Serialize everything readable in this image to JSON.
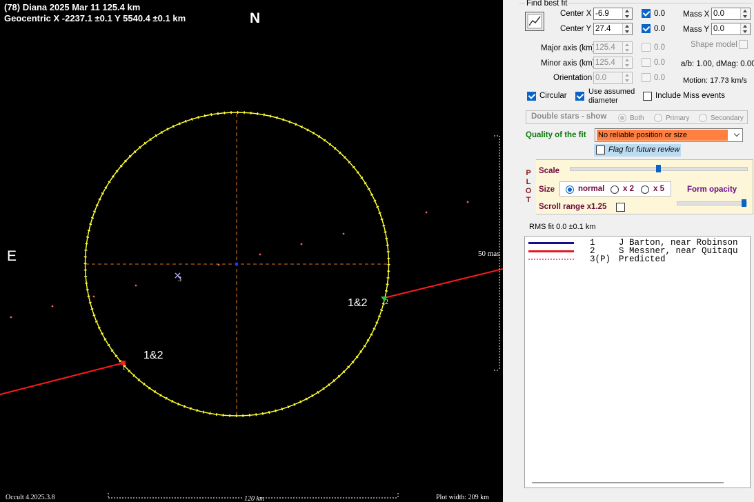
{
  "plot": {
    "title": "(78) Diana  2025 Mar 11   125.4 km",
    "geocentric": "Geocentric  X  -2237.1 ±0.1  Y 5540.4 ±0.1 km",
    "north_label": "N",
    "east_label": "E",
    "chord_label_right": "1&2",
    "chord_label_left": "1&2",
    "scale_mas_label": "50 mas",
    "version": "Occult 4.2025.3.8",
    "scale_km_label": "120 km",
    "plot_width": "Plot width: 209 km",
    "markers": {
      "chord1_end": "1",
      "chord2_end": "2",
      "predicted": "3"
    },
    "colors": {
      "ellipse": "#ffff33",
      "chord": "#ff1a1a",
      "axes": "#e07a1a",
      "predicted": "#ff6060",
      "center": "#2030ff"
    }
  },
  "panel": {
    "find_best_fit": "Find best fit",
    "center_x": {
      "label": "Center X",
      "value": "-6.9",
      "check": "0.0"
    },
    "center_y": {
      "label": "Center Y",
      "value": "27.4",
      "check": "0.0"
    },
    "mass_x": {
      "label": "Mass X",
      "value": "0.0"
    },
    "mass_y": {
      "label": "Mass Y",
      "value": "0.0"
    },
    "major_axis": {
      "label": "Major axis (km)",
      "value": "125.4",
      "check": "0.0"
    },
    "minor_axis": {
      "label": "Minor axis (km)",
      "value": "125.4",
      "check": "0.0"
    },
    "orientation": {
      "label": "Orientation",
      "value": "0.0",
      "check": "0.0"
    },
    "shape_model": "Shape model",
    "ab_dmag": "a/b: 1.00, dMag: 0.00",
    "motion": "Motion: 17.73 km/s",
    "circular": "Circular",
    "use_assumed_1": "Use assumed",
    "use_assumed_2": "diameter",
    "include_miss": "Include Miss events",
    "double_stars": "Double stars - show",
    "both": "Both",
    "primary": "Primary",
    "secondary": "Secondary",
    "quality_label": "Quality of the fit",
    "quality_value": "No reliable position or size",
    "flag_future": "Flag for future review",
    "plot_vertical": [
      "P",
      "L",
      "O",
      "T"
    ],
    "scale_label": "Scale",
    "size_label": "Size",
    "size_normal": "normal",
    "size_x2": "x 2",
    "size_x5": "x 5",
    "form_opacity": "Form opacity",
    "scroll_range": "Scroll range x1.25",
    "rms_fit": "RMS fit 0.0 ±0.1 km",
    "scale_slider_fraction": 0.5,
    "opacity_slider_fraction": 1.0,
    "legend": [
      {
        "num": "1",
        "name": "J Barton, near Robinson",
        "color": "#1a0a8c",
        "style": "solid"
      },
      {
        "num": "2",
        "name": "S Messner, near Quitaqu",
        "color": "#e8141e",
        "style": "solid"
      },
      {
        "num": "3(P)",
        "name": "Predicted",
        "color": "#ff6080",
        "style": "dotted"
      }
    ]
  }
}
